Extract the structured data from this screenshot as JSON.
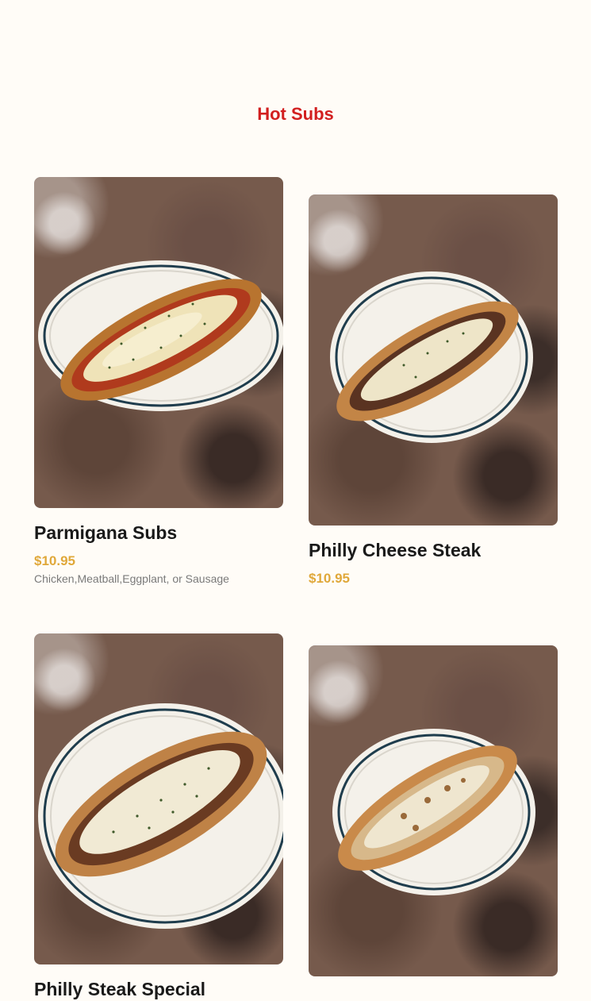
{
  "section": {
    "title": "Hot Subs"
  },
  "items": [
    {
      "name": "Parmigana Subs",
      "price": "$10.95",
      "description": "Chicken,Meatball,Eggplant, or Sausage",
      "photo_icon": "parmigiana-sub-photo"
    },
    {
      "name": "Philly Cheese Steak",
      "price": "$10.95",
      "description": "",
      "photo_icon": "philly-cheese-steak-photo"
    },
    {
      "name": "Philly Steak Special",
      "price": "",
      "description": "",
      "photo_icon": "philly-steak-special-photo"
    },
    {
      "name": "",
      "price": "",
      "description": "",
      "photo_icon": "chicken-sub-photo"
    }
  ],
  "colors": {
    "accent_title": "#d21f1f",
    "price": "#e0a83a",
    "background": "#fffcf7"
  }
}
